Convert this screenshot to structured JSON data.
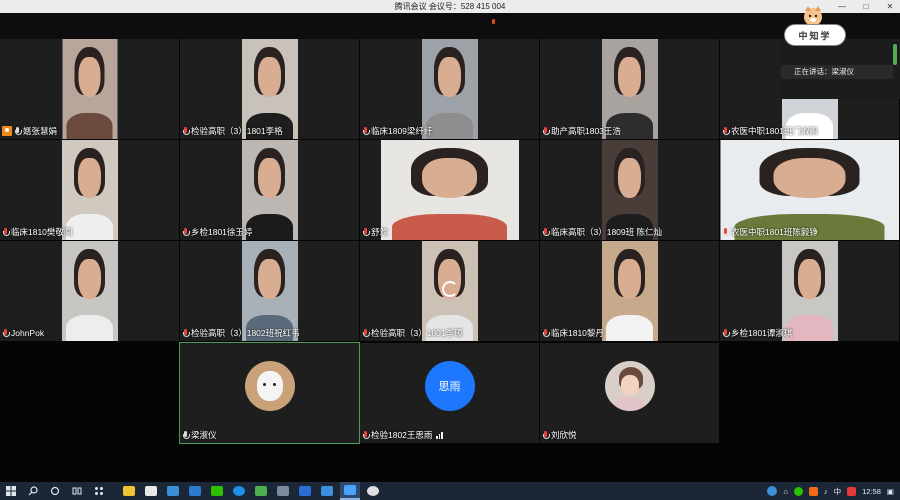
{
  "window": {
    "title": "腾讯会议 会议号：528 415 004",
    "controls": [
      "—",
      "□",
      "✕"
    ]
  },
  "speaker_panel": {
    "logo_text": "中知学",
    "speaking_label": "正在讲话：",
    "speaking_name": "梁淑仪"
  },
  "participants": [
    {
      "name": "嫕张慧娟",
      "host": true,
      "muted": false
    },
    {
      "name": "检验高职（3）1801李格",
      "host": false,
      "muted": true
    },
    {
      "name": "临床1809梁纤纤",
      "host": false,
      "muted": true
    },
    {
      "name": "助产高职1803王浩",
      "host": false,
      "muted": true
    },
    {
      "name": "农医中职1801班门淑鹏",
      "host": false,
      "muted": true
    },
    {
      "name": "临床1810樊敬闯",
      "host": false,
      "muted": true
    },
    {
      "name": "乡检1801徐玉婷",
      "host": false,
      "muted": true
    },
    {
      "name": "舒欢",
      "host": false,
      "muted": true
    },
    {
      "name": "临床高职（3）1809班 陈仁灿",
      "host": false,
      "muted": true
    },
    {
      "name": "农医中职1801班陈毅铮",
      "host": false,
      "muted": true
    },
    {
      "name": "JohnPok",
      "host": false,
      "muted": true
    },
    {
      "name": "检验高职（3）1802班祝红韦",
      "host": false,
      "muted": true
    },
    {
      "name": "检验高职（3）1801李硕",
      "host": false,
      "muted": true
    },
    {
      "name": "临床1810黎丹",
      "host": false,
      "muted": true
    },
    {
      "name": "乡检1801谭淑琪",
      "host": false,
      "muted": true
    },
    {
      "name": "梁淑仪",
      "host": false,
      "muted": false
    },
    {
      "name": "检验1802王思雨",
      "host": false,
      "muted": true,
      "avatar_text": "思雨"
    },
    {
      "name": "刘欣悦",
      "host": false,
      "muted": true
    }
  ],
  "taskbar": {
    "clock": "12:58",
    "ime": "中",
    "tray_icons": [
      "help-icon",
      "network-icon",
      "volume-icon",
      "ime-icon",
      "notification-icon"
    ],
    "apps": [
      "file-explorer-icon",
      "store-icon",
      "settings-icon",
      "mail-icon",
      "wechat-icon",
      "edge-icon",
      "media-icon",
      "photos-icon",
      "meeting-icon",
      "app-icon"
    ]
  }
}
